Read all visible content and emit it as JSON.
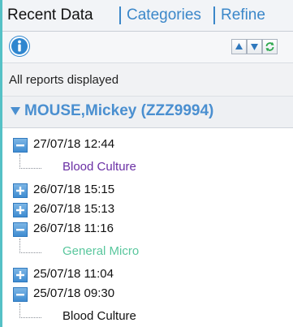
{
  "tabs": [
    {
      "label": "Recent Data",
      "active": true
    },
    {
      "label": "Categories",
      "active": false
    },
    {
      "label": "Refine",
      "active": false
    }
  ],
  "toolbar": {
    "info_icon": "info-icon",
    "up_icon": "arrow-up-icon",
    "down_icon": "arrow-down-icon",
    "refresh_icon": "refresh-icon"
  },
  "status": {
    "text": "All reports displayed"
  },
  "patient": {
    "name": "MOUSE,Mickey (ZZZ9994)"
  },
  "entries": [
    {
      "datetime": "27/07/18 12:44",
      "expanded": true,
      "children": [
        {
          "label": "Blood Culture",
          "color": "#6a2fa4"
        }
      ]
    },
    {
      "datetime": "26/07/18 15:15",
      "expanded": false,
      "children": []
    },
    {
      "datetime": "26/07/18 15:13",
      "expanded": false,
      "children": []
    },
    {
      "datetime": "26/07/18 11:16",
      "expanded": true,
      "children": [
        {
          "label": "General Micro",
          "color": "#59c79d"
        }
      ]
    },
    {
      "datetime": "25/07/18 11:04",
      "expanded": false,
      "children": []
    },
    {
      "datetime": "25/07/18 09:30",
      "expanded": true,
      "children": [
        {
          "label": "Blood Culture",
          "color": "#111111"
        }
      ]
    }
  ],
  "colors": {
    "accent": "#55c1c6",
    "tab_link": "#3b87c9",
    "patient_name": "#4a8fd0"
  }
}
